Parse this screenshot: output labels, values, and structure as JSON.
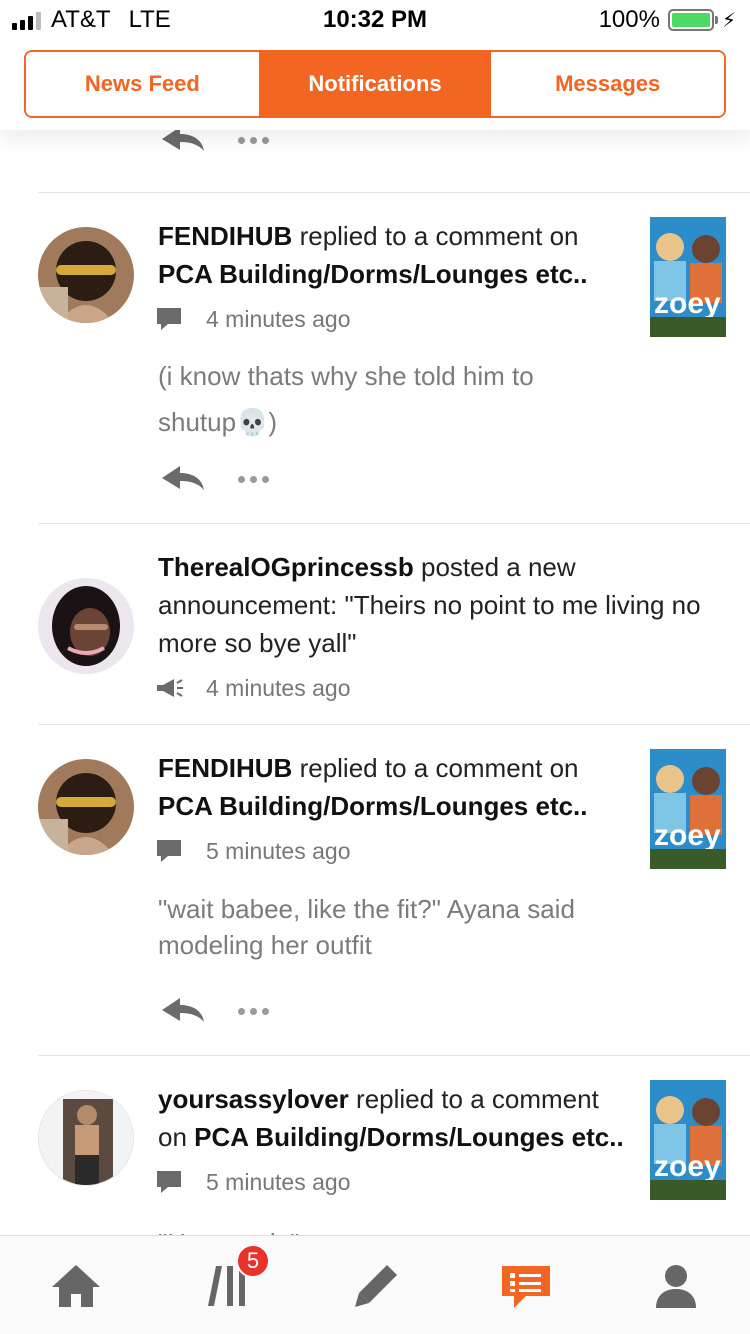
{
  "status_bar": {
    "carrier": "AT&T",
    "network": "LTE",
    "time": "10:32 PM",
    "battery": "100%",
    "battery_level": 1.0,
    "signal_bars": 3
  },
  "tabs": [
    {
      "label": "News Feed",
      "active": false
    },
    {
      "label": "Notifications",
      "active": true
    },
    {
      "label": "Messages",
      "active": false
    }
  ],
  "notifications": [
    {
      "user": "FENDIHUB",
      "action": "replied to a comment on",
      "target": "PCA Building/Dorms/Lounges etc..",
      "time": "4 minutes ago",
      "icon": "comment-icon",
      "body": "(i know thats why she told him to shutup💀)"
    },
    {
      "user": "TherealOGprincessb",
      "action": "posted a new announcement: \"Theirs no point to me living no more so bye yall\"",
      "time": "4 minutes ago",
      "icon": "megaphone-icon"
    },
    {
      "user": "FENDIHUB",
      "action": "replied to a comment on",
      "target": "PCA Building/Dorms/Lounges etc..",
      "time": "5 minutes ago",
      "icon": "comment-icon",
      "body": "\"wait babee, like the fit?\" Ayana said modeling her outfit"
    },
    {
      "user": "yoursassylover",
      "action": "replied to a comment on",
      "target": "PCA Building/Dorms/Lounges etc..",
      "time": "5 minutes ago",
      "icon": "comment-icon",
      "body": "\"Hey austin\""
    }
  ],
  "bottom_nav": {
    "items": [
      "home-icon",
      "stories-icon",
      "write-icon",
      "notifications-icon",
      "profile-icon"
    ],
    "stories_badge": "5",
    "active_color": "#f26522"
  },
  "colors": {
    "accent": "#f26522",
    "badge": "#e8332b"
  }
}
